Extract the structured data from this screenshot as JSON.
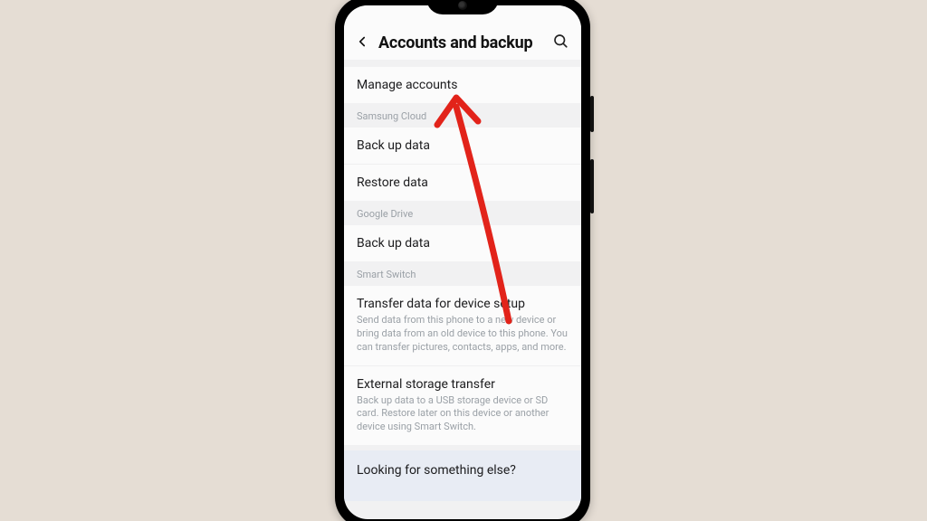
{
  "header": {
    "title": "Accounts and backup"
  },
  "top_item": {
    "manage_accounts": "Manage accounts"
  },
  "sections": {
    "samsung_cloud": {
      "label": "Samsung Cloud",
      "backup": "Back up data",
      "restore": "Restore data"
    },
    "google_drive": {
      "label": "Google Drive",
      "backup": "Back up data"
    },
    "smart_switch": {
      "label": "Smart Switch",
      "transfer_title": "Transfer data for device setup",
      "transfer_desc": "Send data from this phone to a new device or bring data from an old device to this phone. You can transfer pictures, contacts, apps, and more.",
      "external_title": "External storage transfer",
      "external_desc": "Back up data to a USB storage device or SD card. Restore later on this device or another device using Smart Switch."
    }
  },
  "footer": {
    "question": "Looking for something else?"
  },
  "annotation": {
    "color": "#e2231a"
  }
}
